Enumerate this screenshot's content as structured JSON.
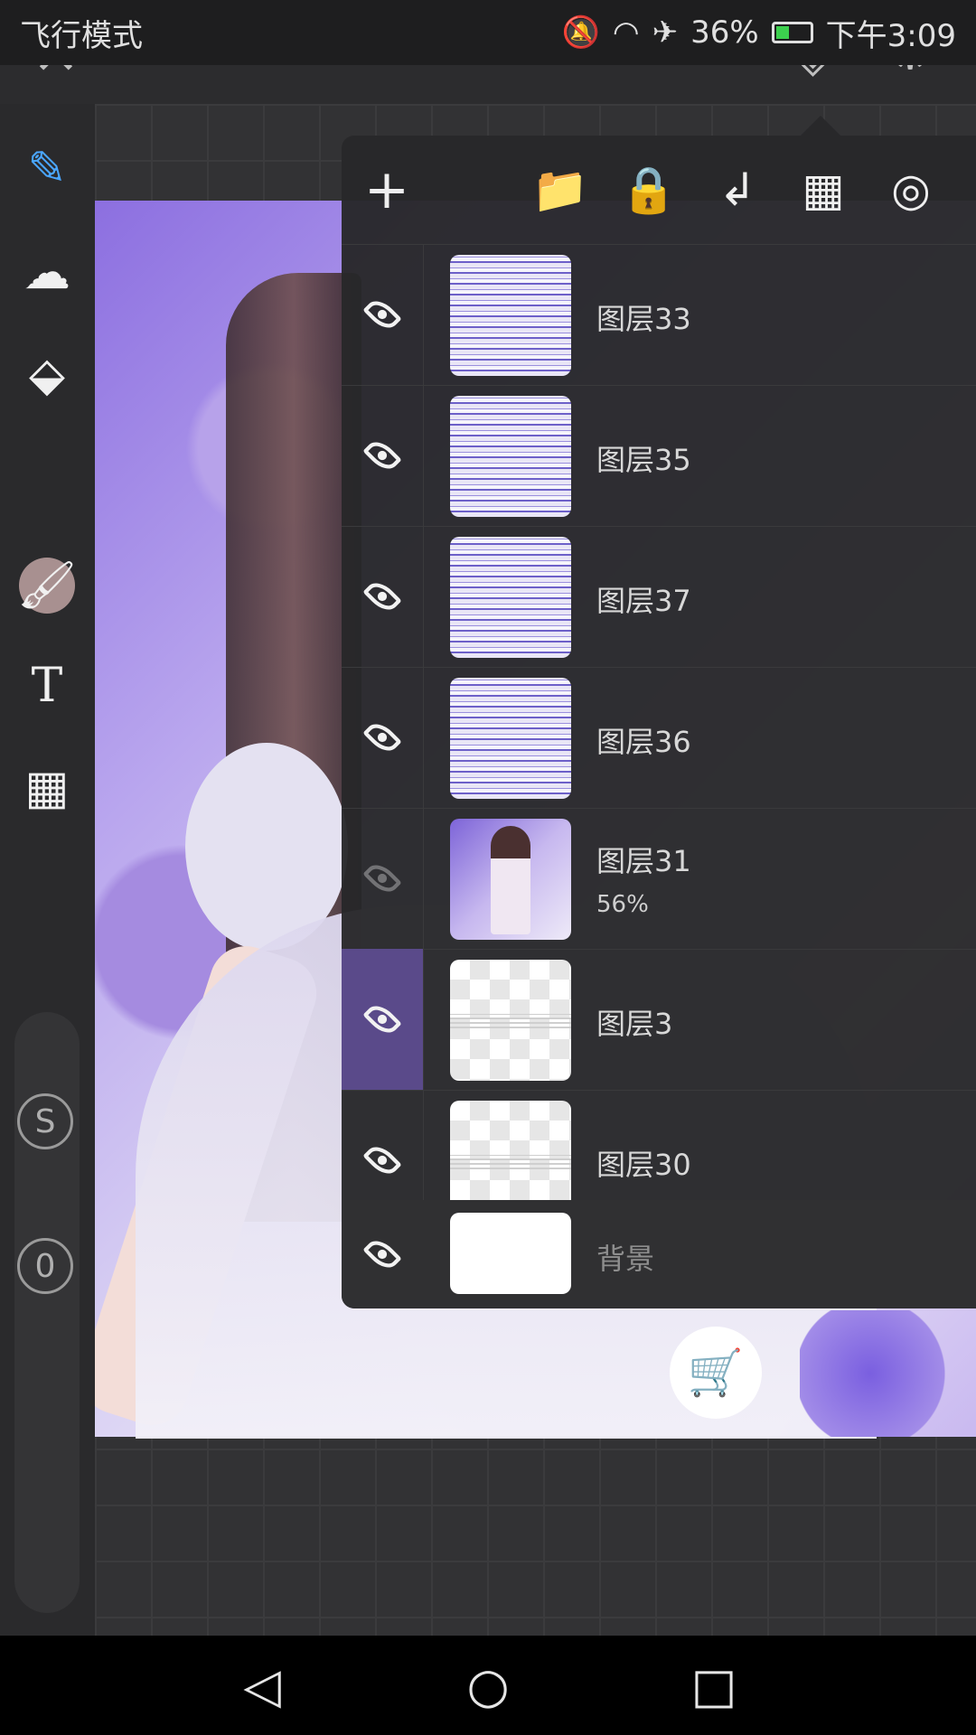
{
  "status_bar": {
    "left_text": "飞行模式",
    "battery_percent": "36%",
    "time": "下午3:09",
    "icons": [
      "mute-icon",
      "wifi-icon",
      "airplane-icon",
      "battery-icon"
    ]
  },
  "top_toolbar": {
    "icons": [
      "close-icon",
      "undo-icon",
      "redo-icon",
      "layers-icon",
      "settings-icon"
    ]
  },
  "left_toolbar": {
    "tools": [
      "pen-icon",
      "smudge-icon",
      "eraser-icon",
      "color-swatch",
      "brush-icon",
      "text-icon",
      "grid-icon"
    ],
    "text_tool_glyph": "T",
    "current_color": "#a89090",
    "slider_badge_top": "S",
    "slider_badge_bottom": "0"
  },
  "layers_panel": {
    "toolbar_icons": [
      "add-icon",
      "folder-icon",
      "lock-icon",
      "merge-down-icon",
      "transparency-icon",
      "target-icon"
    ],
    "add_glyph": "+",
    "layers": [
      {
        "name": "图层33",
        "visible": true,
        "thumb": "stripes",
        "opacity": ""
      },
      {
        "name": "图层35",
        "visible": true,
        "thumb": "stripes",
        "opacity": ""
      },
      {
        "name": "图层37",
        "visible": true,
        "thumb": "stripes",
        "opacity": ""
      },
      {
        "name": "图层36",
        "visible": true,
        "thumb": "stripes",
        "opacity": ""
      },
      {
        "name": "图层31",
        "visible": false,
        "thumb": "art",
        "opacity": "56%"
      },
      {
        "name": "图层3",
        "visible": true,
        "thumb": "checker",
        "opacity": "",
        "selected": true
      },
      {
        "name": "图层30",
        "visible": true,
        "thumb": "checker",
        "opacity": ""
      }
    ],
    "background_layer": {
      "name": "背景",
      "visible": true
    }
  },
  "accent_color": "#5a4a8a",
  "navbar": {
    "icons": [
      "back-icon",
      "home-icon",
      "recents-icon"
    ]
  }
}
